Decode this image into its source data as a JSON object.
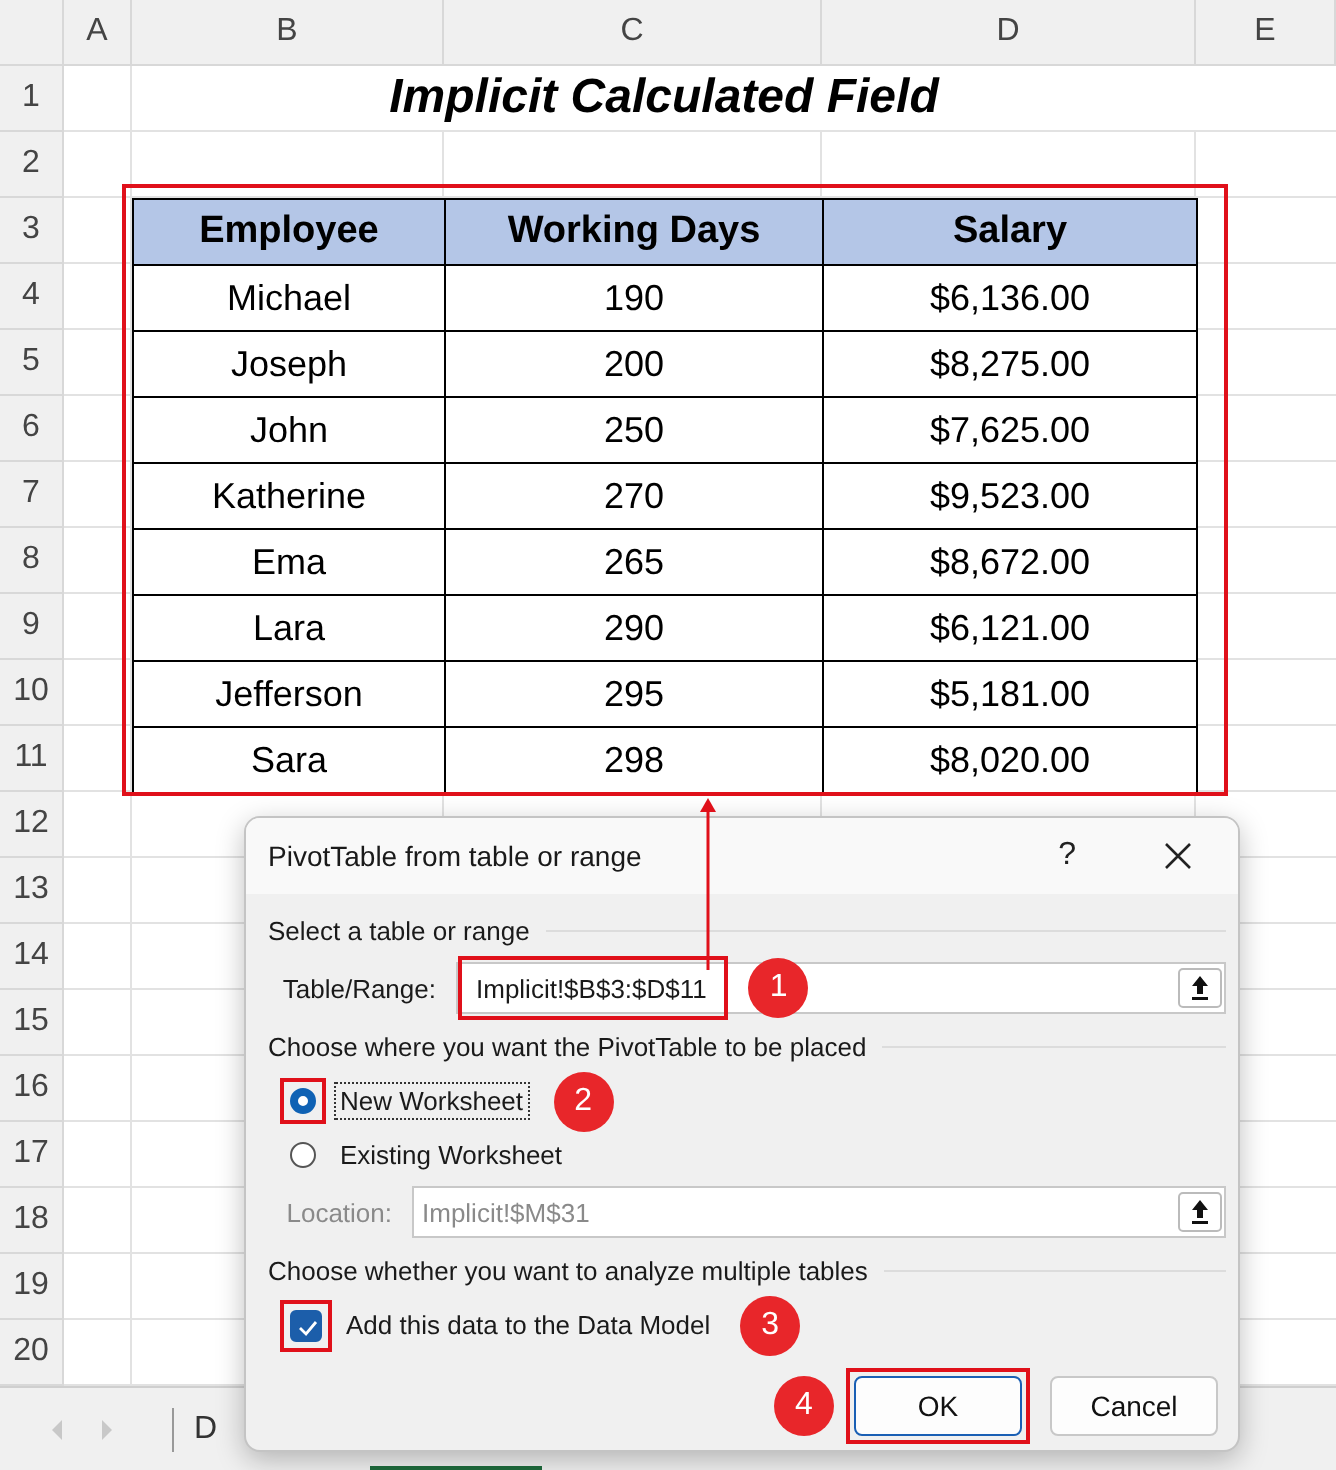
{
  "sheet": {
    "columns": [
      "A",
      "B",
      "C",
      "D",
      "E"
    ],
    "rows": [
      "1",
      "2",
      "3",
      "4",
      "5",
      "6",
      "7",
      "8",
      "9",
      "10",
      "11",
      "12",
      "13",
      "14",
      "15",
      "16",
      "17",
      "18",
      "19",
      "20"
    ],
    "title": "Implicit Calculated Field",
    "table": {
      "highlighted": true,
      "columns": [
        "Employee",
        "Working Days",
        "Salary"
      ],
      "rows": [
        [
          "Michael",
          "190",
          "$6,136.00"
        ],
        [
          "Joseph",
          "200",
          "$8,275.00"
        ],
        [
          "John",
          "250",
          "$7,625.00"
        ],
        [
          "Katherine",
          "270",
          "$9,523.00"
        ],
        [
          "Ema",
          "265",
          "$8,672.00"
        ],
        [
          "Lara",
          "290",
          "$6,121.00"
        ],
        [
          "Jefferson",
          "295",
          "$5,181.00"
        ],
        [
          "Sara",
          "298",
          "$8,020.00"
        ]
      ]
    }
  },
  "sheet_tabs": [
    {
      "label": "D"
    }
  ],
  "dialog": {
    "title": "PivotTable from table or range",
    "help": "?",
    "section_1": "Select a table or range",
    "range_field": {
      "label": "Table/Range:",
      "value": "Implicit!$B$3:$D$11",
      "highlighted": true,
      "callout": "1"
    },
    "section_2": "Choose where you want the PivotTable to be placed",
    "radios": [
      {
        "label": "New Worksheet",
        "selected": true,
        "highlighted": true,
        "callout": "2"
      },
      {
        "label": "Existing Worksheet",
        "selected": false,
        "highlighted": false
      }
    ],
    "location_field": {
      "label": "Location:",
      "value": "Implicit!$M$31",
      "disabled": true
    },
    "section_3": "Choose whether you want to analyze multiple tables",
    "checkbox": {
      "label": "Add this data to the Data Model",
      "checked": true,
      "highlighted": true,
      "callout": "3"
    },
    "buttons": [
      {
        "label": "OK",
        "default": true,
        "highlighted": true,
        "callout": "4"
      },
      {
        "label": "Cancel",
        "default": false,
        "highlighted": false
      }
    ]
  }
}
